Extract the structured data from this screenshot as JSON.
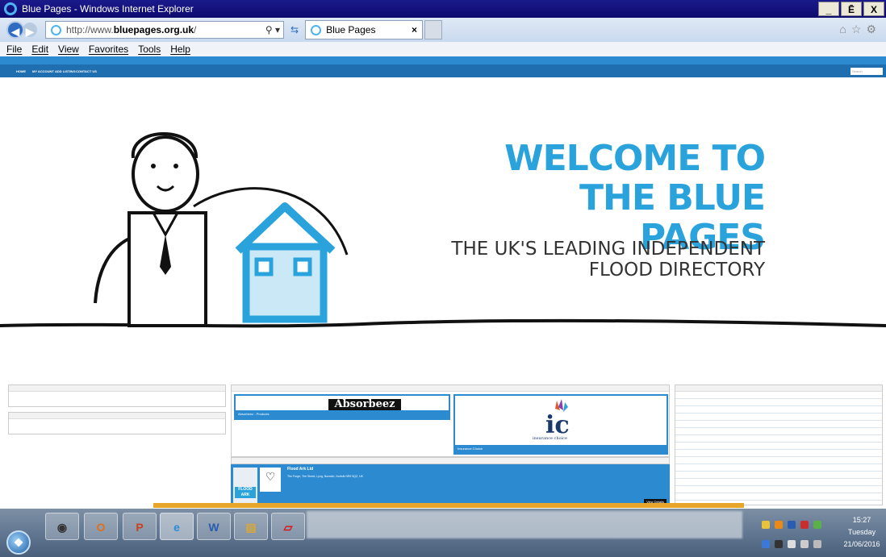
{
  "window": {
    "title": "Blue Pages - Windows Internet Explorer",
    "controls": [
      "_",
      "Ē",
      "X"
    ]
  },
  "address_bar": {
    "url_prefix": "http://www.",
    "url_domain": "bluepages.org.uk",
    "url_suffix": "/",
    "search_icon": "search-icon"
  },
  "tab": {
    "label": "Blue Pages",
    "close": "×"
  },
  "menu": [
    "File",
    "Edit",
    "View",
    "Favorites",
    "Tools",
    "Help"
  ],
  "site": {
    "nav": [
      "HOME",
      "MY ACCOUNT",
      "ADD LISTING",
      "CONTACT US"
    ],
    "search_placeholder": "Search",
    "hero": {
      "welcome_line1": "WELCOME TO",
      "welcome_line2": "THE BLUE PAGES",
      "tagline_line1": "THE UK'S LEADING INDEPENDENT",
      "tagline_line2": "FLOOD DIRECTORY"
    },
    "featured_listings": [
      {
        "logo_text": "Absorbeez",
        "caption": "Absorbeez - Products"
      },
      {
        "logo_text": "ic",
        "logo_sub": "insurance choice",
        "caption": "Insurance Choice"
      }
    ],
    "recent_listing": {
      "name": "Flood Ark Ltd",
      "address": "The Forge, The Street, Lyng, Norwich, Norfolk NR9 5QZ, UK",
      "view": "View Details",
      "logo_label": "FLOOD ARK"
    }
  },
  "taskbar": {
    "start_icon": "windows-orb-icon",
    "apps": [
      "media-player-icon",
      "outlook-icon",
      "powerpoint-icon",
      "internet-explorer-icon",
      "word-icon",
      "file-explorer-icon",
      "pdf-icon"
    ],
    "clock_time": "15:27",
    "clock_day": "Tuesday",
    "clock_date": "21/06/2016"
  }
}
